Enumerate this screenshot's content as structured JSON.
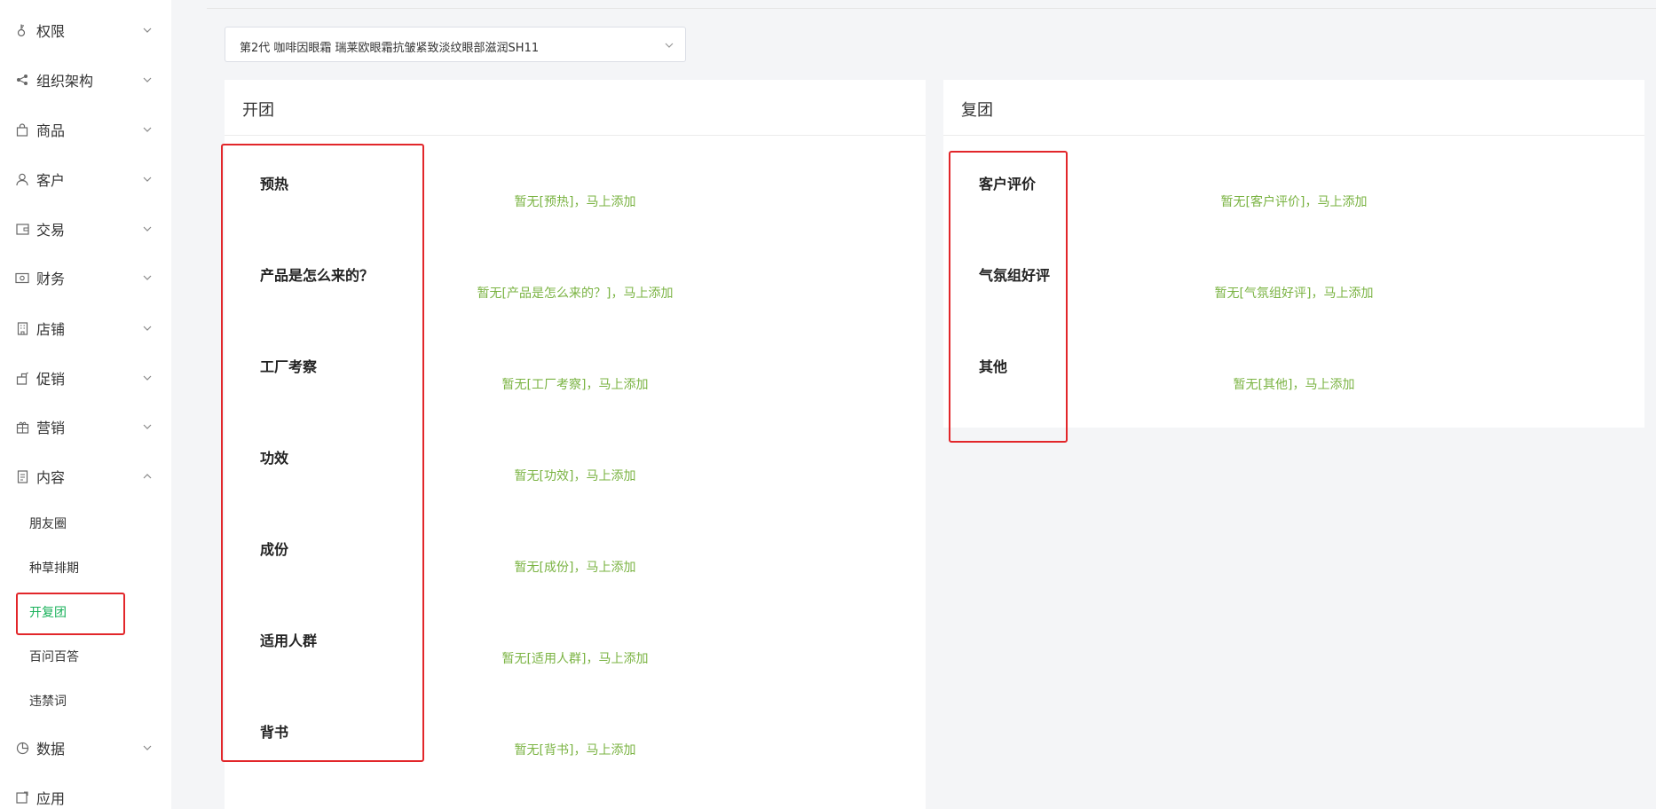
{
  "sidebar": {
    "items": [
      {
        "label": "权限",
        "icon": "key-icon",
        "expanded": false
      },
      {
        "label": "组织架构",
        "icon": "share-icon",
        "expanded": false
      },
      {
        "label": "商品",
        "icon": "bag-icon",
        "expanded": false
      },
      {
        "label": "客户",
        "icon": "user-icon",
        "expanded": false
      },
      {
        "label": "交易",
        "icon": "wallet-icon",
        "expanded": false
      },
      {
        "label": "财务",
        "icon": "money-icon",
        "expanded": false
      },
      {
        "label": "店铺",
        "icon": "building-icon",
        "expanded": false
      },
      {
        "label": "促销",
        "icon": "promotion-icon",
        "expanded": false
      },
      {
        "label": "营销",
        "icon": "gift-icon",
        "expanded": false
      },
      {
        "label": "内容",
        "icon": "document-icon",
        "expanded": true
      },
      {
        "label": "数据",
        "icon": "pie-chart-icon",
        "expanded": false
      },
      {
        "label": "应用",
        "icon": "app-icon",
        "expanded": false
      }
    ],
    "content_subitems": [
      {
        "label": "朋友圈",
        "active": false
      },
      {
        "label": "种草排期",
        "active": false
      },
      {
        "label": "开复团",
        "active": true
      },
      {
        "label": "百问百答",
        "active": false
      },
      {
        "label": "违禁词",
        "active": false
      }
    ]
  },
  "product_select": {
    "value": "第2代  咖啡因眼霜  瑞莱欧眼霜抗皱紧致淡纹眼部滋润SH11"
  },
  "open_group": {
    "title": "开团",
    "rows": [
      {
        "label": "预热",
        "link": "暂无[预热]，马上添加"
      },
      {
        "label": "产品是怎么来的？",
        "link": "暂无[产品是怎么来的？]，马上添加"
      },
      {
        "label": "工厂考察",
        "link": "暂无[工厂考察]，马上添加"
      },
      {
        "label": "功效",
        "link": "暂无[功效]，马上添加"
      },
      {
        "label": "成份",
        "link": "暂无[成份]，马上添加"
      },
      {
        "label": "适用人群",
        "link": "暂无[适用人群]，马上添加"
      },
      {
        "label": "背书",
        "link": "暂无[背书]，马上添加"
      }
    ]
  },
  "re_group": {
    "title": "复团",
    "rows": [
      {
        "label": "客户评价",
        "link": "暂无[客户评价]，马上添加"
      },
      {
        "label": "气氛组好评",
        "link": "暂无[气氛组好评]，马上添加"
      },
      {
        "label": "其他",
        "link": "暂无[其他]，马上添加"
      }
    ]
  },
  "colors": {
    "accent_green": "#19b15a",
    "link_green": "#7ab342",
    "annotation_red": "#e2262a"
  }
}
